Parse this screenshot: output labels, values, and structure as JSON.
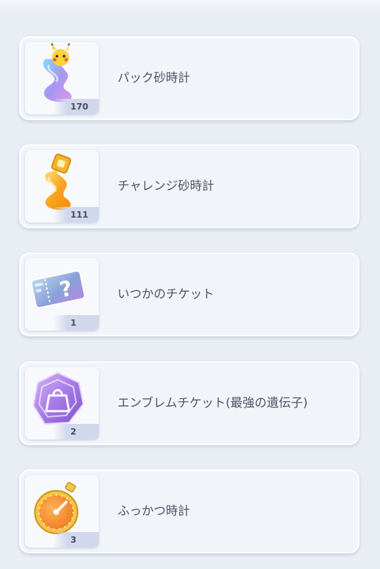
{
  "items": [
    {
      "name": "パック砂時計",
      "count": "170",
      "icon": "pack-hourglass-icon"
    },
    {
      "name": "チャレンジ砂時計",
      "count": "111",
      "icon": "challenge-hourglass-icon"
    },
    {
      "name": "いつかのチケット",
      "count": "1",
      "icon": "mystery-ticket-icon"
    },
    {
      "name": "エンブレムチケット(最強の遺伝子)",
      "count": "2",
      "icon": "emblem-ticket-icon"
    },
    {
      "name": "ふっかつ時計",
      "count": "3",
      "icon": "revival-stopwatch-icon"
    }
  ]
}
